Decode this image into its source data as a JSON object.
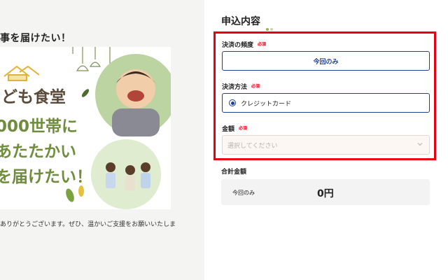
{
  "left": {
    "heading": "事を届けたい！",
    "hero_lines": [
      "ども食堂",
      "000世帯に",
      "あたたかい",
      "を届けたい！"
    ],
    "caption": "ありがとうございます。ぜひ、温かいご支援をお願いいたしま"
  },
  "form": {
    "section_title": "申込内容",
    "required_badge": "必須",
    "frequency": {
      "label": "決済の頻度",
      "selected": "今回のみ"
    },
    "method": {
      "label": "決済方法",
      "option": "クレジットカード"
    },
    "amount": {
      "label": "金額",
      "placeholder": "選択してください"
    },
    "total": {
      "label": "合計金額",
      "frequency": "今回のみ",
      "value": "0円"
    }
  },
  "colors": {
    "highlight": "#e60012",
    "accent_navy": "#1f3f8f",
    "required_red": "#e60012",
    "brand_green": "#6f8d3c",
    "dot_green": "#8dbb4b",
    "dot_light": "#c9dba5"
  }
}
